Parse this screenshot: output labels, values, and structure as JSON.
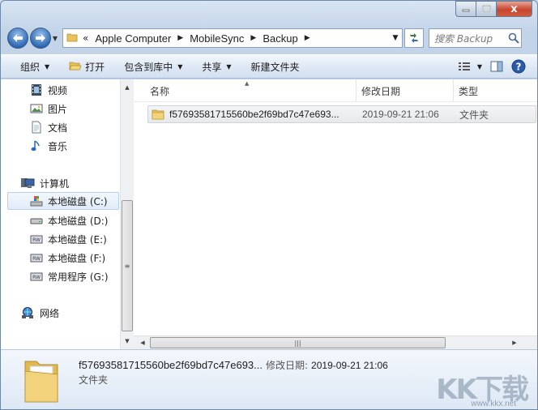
{
  "window": {
    "close_glyph": "x"
  },
  "address": {
    "overflow": "«",
    "crumbs": [
      "Apple Computer",
      "MobileSync",
      "Backup"
    ]
  },
  "search": {
    "placeholder": "搜索 Backup"
  },
  "toolbar": {
    "organize": "组织",
    "open": "打开",
    "include_in_library": "包含到库中",
    "share": "共享",
    "new_folder": "新建文件夹"
  },
  "navpane": {
    "items": [
      {
        "label": "视频",
        "icon": "video-icon"
      },
      {
        "label": "图片",
        "icon": "pictures-icon"
      },
      {
        "label": "文档",
        "icon": "documents-icon"
      },
      {
        "label": "音乐",
        "icon": "music-icon"
      },
      {
        "label": "计算机",
        "icon": "computer-icon"
      },
      {
        "label": "本地磁盘 (C:)",
        "icon": "system-drive-icon"
      },
      {
        "label": "本地磁盘 (D:)",
        "icon": "drive-icon"
      },
      {
        "label": "本地磁盘 (E:)",
        "icon": "drive-icon"
      },
      {
        "label": "本地磁盘 (F:)",
        "icon": "drive-icon"
      },
      {
        "label": "常用程序 (G:)",
        "icon": "drive-icon"
      },
      {
        "label": "网络",
        "icon": "network-icon"
      }
    ]
  },
  "content": {
    "columns": {
      "name": "名称",
      "date": "修改日期",
      "type": "类型"
    },
    "rows": [
      {
        "name": "f57693581715560be2f69bd7c47e693...",
        "date": "2019-09-21 21:06",
        "type": "文件夹"
      }
    ]
  },
  "details": {
    "name": "f57693581715560be2f69bd7c47e693...",
    "date_label": "修改日期:",
    "date": "2019-09-21 21:06",
    "type": "文件夹"
  },
  "watermark": {
    "text": "KK下载",
    "url": "www.kkx.net"
  },
  "colors": {
    "accent": "#2f6ab3",
    "close": "#c7462e",
    "folder": "#e8c25a"
  }
}
